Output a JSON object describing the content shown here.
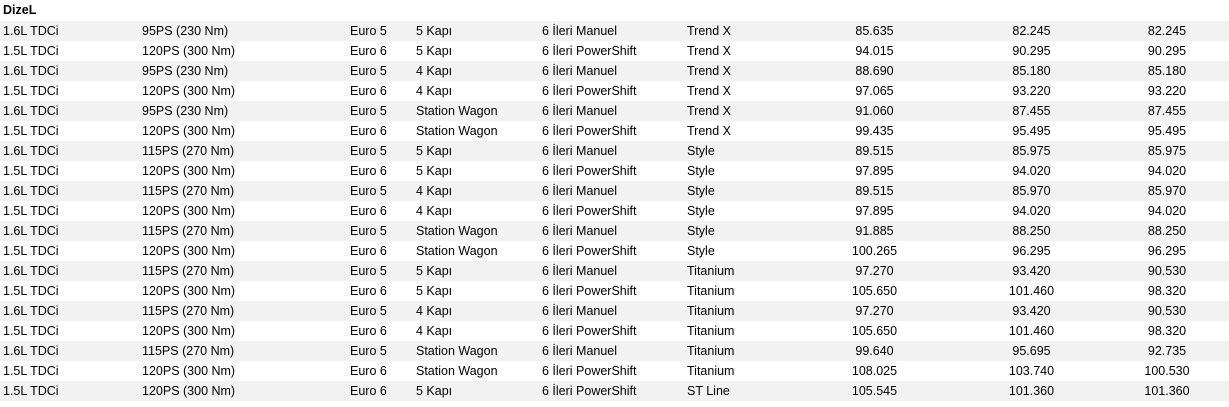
{
  "section_title": "DizeL",
  "rows": [
    [
      "1.6L TDCi",
      "95PS (230 Nm)",
      "Euro 5",
      "5 Kapı",
      "6 İleri Manuel",
      "Trend X",
      "85.635",
      "82.245",
      "82.245"
    ],
    [
      "1.5L TDCi",
      "120PS (300 Nm)",
      "Euro 6",
      "5 Kapı",
      "6 İleri PowerShift",
      "Trend X",
      "94.015",
      "90.295",
      "90.295"
    ],
    [
      "1.6L TDCi",
      "95PS (230 Nm)",
      "Euro 5",
      "4 Kapı",
      "6 İleri Manuel",
      "Trend X",
      "88.690",
      "85.180",
      "85.180"
    ],
    [
      "1.5L TDCi",
      "120PS (300 Nm)",
      "Euro 6",
      "4 Kapı",
      "6 İleri PowerShift",
      "Trend X",
      "97.065",
      "93.220",
      "93.220"
    ],
    [
      "1.6L TDCi",
      "95PS (230 Nm)",
      "Euro 5",
      "Station Wagon",
      "6 İleri Manuel",
      "Trend X",
      "91.060",
      "87.455",
      "87.455"
    ],
    [
      "1.5L TDCi",
      "120PS (300 Nm)",
      "Euro 6",
      "Station Wagon",
      "6 İleri PowerShift",
      "Trend X",
      "99.435",
      "95.495",
      "95.495"
    ],
    [
      "1.6L TDCi",
      "115PS (270 Nm)",
      "Euro 5",
      "5 Kapı",
      "6 İleri Manuel",
      "Style",
      "89.515",
      "85.975",
      "85.975"
    ],
    [
      "1.5L TDCi",
      "120PS (300 Nm)",
      "Euro 6",
      "5 Kapı",
      "6 İleri PowerShift",
      "Style",
      "97.895",
      "94.020",
      "94.020"
    ],
    [
      "1.6L TDCi",
      "115PS (270 Nm)",
      "Euro 5",
      "4 Kapı",
      "6 İleri Manuel",
      "Style",
      "89.515",
      "85.970",
      "85.970"
    ],
    [
      "1.5L TDCi",
      "120PS (300 Nm)",
      "Euro 6",
      "4 Kapı",
      "6 İleri PowerShift",
      "Style",
      "97.895",
      "94.020",
      "94.020"
    ],
    [
      "1.6L TDCi",
      "115PS (270 Nm)",
      "Euro 5",
      "Station Wagon",
      "6 İleri Manuel",
      "Style",
      "91.885",
      "88.250",
      "88.250"
    ],
    [
      "1.5L TDCi",
      "120PS (300 Nm)",
      "Euro 6",
      "Station Wagon",
      "6 İleri PowerShift",
      "Style",
      "100.265",
      "96.295",
      "96.295"
    ],
    [
      "1.6L TDCi",
      "115PS (270 Nm)",
      "Euro 5",
      "5 Kapı",
      "6 İleri Manuel",
      "Titanium",
      "97.270",
      "93.420",
      "90.530"
    ],
    [
      "1.5L TDCi",
      "120PS (300 Nm)",
      "Euro 6",
      "5 Kapı",
      "6 İleri PowerShift",
      "Titanium",
      "105.650",
      "101.460",
      "98.320"
    ],
    [
      "1.6L TDCi",
      "115PS (270 Nm)",
      "Euro 5",
      "4 Kapı",
      "6 İleri Manuel",
      "Titanium",
      "97.270",
      "93.420",
      "90.530"
    ],
    [
      "1.5L TDCi",
      "120PS (300 Nm)",
      "Euro 6",
      "4 Kapı",
      "6 İleri PowerShift",
      "Titanium",
      "105.650",
      "101.460",
      "98.320"
    ],
    [
      "1.6L TDCi",
      "115PS (270 Nm)",
      "Euro 5",
      "Station Wagon",
      "6 İleri Manuel",
      "Titanium",
      "99.640",
      "95.695",
      "92.735"
    ],
    [
      "1.5L TDCi",
      "120PS (300 Nm)",
      "Euro 6",
      "Station Wagon",
      "6 İleri PowerShift",
      "Titanium",
      "108.025",
      "103.740",
      "100.530"
    ],
    [
      "1.5L TDCi",
      "120PS (300 Nm)",
      "Euro 6",
      "5 Kapı",
      "6 İleri PowerShift",
      "ST Line",
      "105.545",
      "101.360",
      "101.360"
    ]
  ]
}
